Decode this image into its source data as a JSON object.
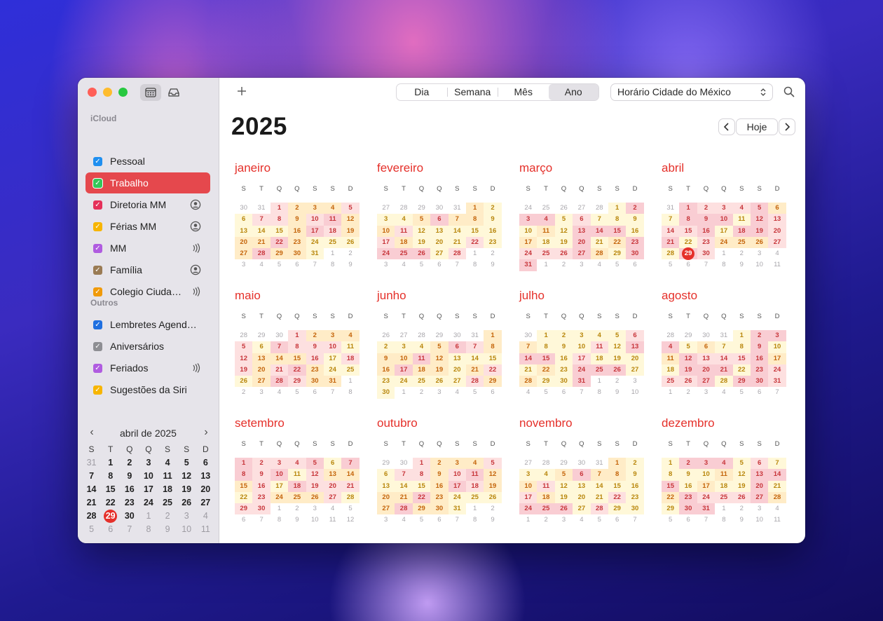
{
  "window": {
    "toolbar": {
      "views": [
        "Dia",
        "Semana",
        "Mês",
        "Ano"
      ],
      "active_view": "Ano",
      "timezone": "Horário Cidade do México",
      "today_label": "Hoje"
    },
    "year": "2025"
  },
  "sidebar": {
    "section_icloud": "iCloud",
    "section_outros": "Outros",
    "icloud_calendars": [
      {
        "label": "Pessoal",
        "color": "#1f8ff0",
        "ext": ""
      },
      {
        "label": "Trabalho",
        "color": "#34c759",
        "ext": "",
        "selected": true
      },
      {
        "label": "Diretoria MM",
        "color": "#e5305a",
        "ext": "user"
      },
      {
        "label": "Férias MM",
        "color": "#f7b500",
        "ext": "user"
      },
      {
        "label": "MM",
        "color": "#b05ce0",
        "ext": "broadcast"
      },
      {
        "label": "Família",
        "color": "#9a7b54",
        "ext": "user"
      },
      {
        "label": "Colegio Ciuda…",
        "color": "#f09a0a",
        "ext": "broadcast"
      }
    ],
    "other_calendars": [
      {
        "label": "Lembretes Agend…",
        "color": "#1f6fe0",
        "ext": ""
      },
      {
        "label": "Aniversários",
        "color": "#8e8e93",
        "ext": ""
      },
      {
        "label": "Feriados",
        "color": "#b05ce0",
        "ext": "broadcast"
      },
      {
        "label": "Sugestões da Siri",
        "color": "#f7b500",
        "ext": ""
      }
    ],
    "mini_calendar": {
      "title": "abril de 2025",
      "weekdays": [
        "S",
        "T",
        "Q",
        "Q",
        "S",
        "S",
        "D"
      ],
      "weeks": [
        [
          "31",
          "1",
          "2",
          "3",
          "4",
          "5",
          "6"
        ],
        [
          "7",
          "8",
          "9",
          "10",
          "11",
          "12",
          "13"
        ],
        [
          "14",
          "15",
          "16",
          "17",
          "18",
          "19",
          "20"
        ],
        [
          "21",
          "22",
          "23",
          "24",
          "25",
          "26",
          "27"
        ],
        [
          "28",
          "29",
          "30",
          "1",
          "2",
          "3",
          "4"
        ],
        [
          "5",
          "6",
          "7",
          "8",
          "9",
          "10",
          "11"
        ]
      ],
      "today": "29"
    }
  },
  "year_view": {
    "weekdays": [
      "S",
      "T",
      "Q",
      "Q",
      "S",
      "S",
      "D"
    ],
    "months": [
      {
        "name": "janeiro",
        "start": 2,
        "prev_days": 31,
        "days": 31
      },
      {
        "name": "fevereiro",
        "start": 5,
        "prev_days": 31,
        "days": 28
      },
      {
        "name": "março",
        "start": 5,
        "prev_days": 28,
        "days": 31
      },
      {
        "name": "abril",
        "start": 1,
        "prev_days": 31,
        "days": 30
      },
      {
        "name": "maio",
        "start": 3,
        "prev_days": 30,
        "days": 31
      },
      {
        "name": "junho",
        "start": 6,
        "prev_days": 31,
        "days": 30
      },
      {
        "name": "julho",
        "start": 1,
        "prev_days": 30,
        "days": 31
      },
      {
        "name": "agosto",
        "start": 4,
        "prev_days": 31,
        "days": 31
      },
      {
        "name": "setembro",
        "start": 0,
        "prev_days": 31,
        "days": 30
      },
      {
        "name": "outubro",
        "start": 2,
        "prev_days": 30,
        "days": 31
      },
      {
        "name": "novembro",
        "start": 5,
        "prev_days": 31,
        "days": 30
      },
      {
        "name": "dezembro",
        "start": 0,
        "prev_days": 30,
        "days": 31
      }
    ],
    "today": {
      "month": "abril",
      "day": "29"
    }
  }
}
